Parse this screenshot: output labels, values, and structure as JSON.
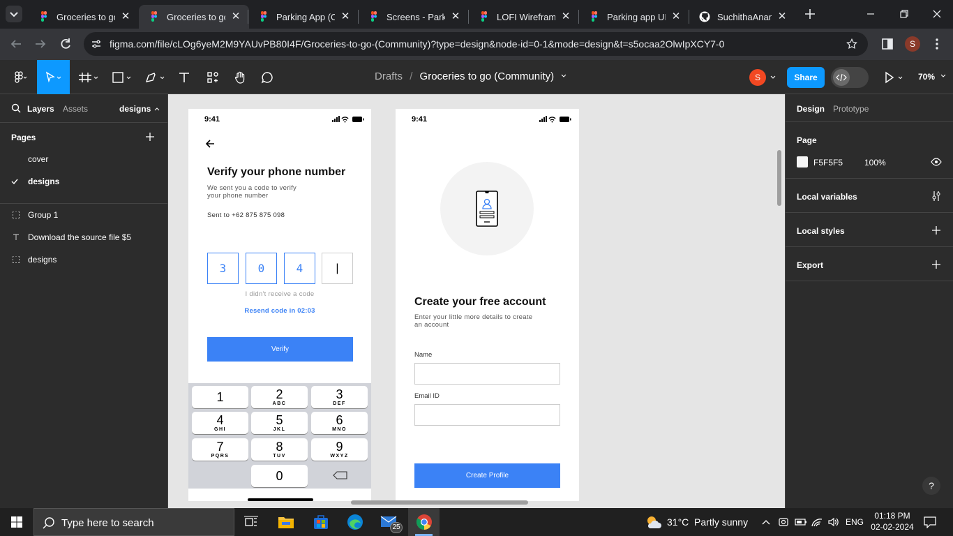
{
  "browser": {
    "tabs": [
      {
        "title": "Groceries to go |",
        "active": false
      },
      {
        "title": "Groceries to go |",
        "active": true
      },
      {
        "title": "Parking App (Co",
        "active": false
      },
      {
        "title": "Screens - Parkin",
        "active": false
      },
      {
        "title": "LOFI Wireframin",
        "active": false
      },
      {
        "title": "Parking app UI U",
        "active": false
      },
      {
        "title": "SuchithaAnand/",
        "active": false
      }
    ],
    "url": "figma.com/file/cLOg6yeM2M9YAUvPB80I4F/Groceries-to-go-(Community)?type=design&node-id=0-1&mode=design&t=s5ocaa2OlwIpXCY7-0",
    "profile_initial": "S"
  },
  "figma": {
    "breadcrumb_parent": "Drafts",
    "breadcrumb_sep": "/",
    "file_title": "Groceries to go (Community)",
    "avatar_initial": "S",
    "share_label": "Share",
    "zoom": "70%",
    "left": {
      "tab_layers": "Layers",
      "tab_assets": "Assets",
      "page_selector": "designs",
      "pages_heading": "Pages",
      "pages": [
        {
          "label": "cover",
          "selected": false
        },
        {
          "label": "designs",
          "selected": true
        }
      ],
      "layers": [
        {
          "label": "Group 1",
          "icon": "frame-icon"
        },
        {
          "label": "Download the source file $5",
          "icon": "text-icon"
        },
        {
          "label": "designs",
          "icon": "frame-icon"
        }
      ]
    },
    "right": {
      "tab_design": "Design",
      "tab_prototype": "Prototype",
      "page_heading": "Page",
      "page_color": "F5F5F5",
      "page_opacity": "100%",
      "local_variables": "Local variables",
      "local_styles": "Local styles",
      "export": "Export",
      "help": "?"
    }
  },
  "verify_screen": {
    "time": "9:41",
    "title": "Verify your phone number",
    "subtitle_line1": "We sent you a code to verify",
    "subtitle_line2": "your phone number",
    "sent_to": "Sent to +62 875 875 098",
    "code_digits": [
      "3",
      "0",
      "4",
      "|"
    ],
    "didnt_receive": "I didn't receive a code",
    "resend": "Resend code in 02:03",
    "verify_button": "Verify",
    "keypad": [
      {
        "digit": "1",
        "letters": ""
      },
      {
        "digit": "2",
        "letters": "ABC"
      },
      {
        "digit": "3",
        "letters": "DEF"
      },
      {
        "digit": "4",
        "letters": "GHI"
      },
      {
        "digit": "5",
        "letters": "JKL"
      },
      {
        "digit": "6",
        "letters": "MNO"
      },
      {
        "digit": "7",
        "letters": "PQRS"
      },
      {
        "digit": "8",
        "letters": "TUV"
      },
      {
        "digit": "9",
        "letters": "WXYZ"
      },
      {
        "digit": "0",
        "letters": ""
      }
    ]
  },
  "create_screen": {
    "time": "9:41",
    "title": "Create your free account",
    "subtitle_line1": "Enter your little more details to create",
    "subtitle_line2": "an account",
    "name_label": "Name",
    "email_label": "Email ID",
    "create_button": "Create Profile"
  },
  "taskbar": {
    "search_placeholder": "Type here to search",
    "mail_badge": "25",
    "weather": "31°C  Partly sunny",
    "language": "ENG",
    "time": "01:18 PM",
    "date": "02-02-2024"
  },
  "colors": {
    "figma_blue": "#0d99ff",
    "accent_blue": "#3b82f6",
    "dark_bg": "#2c2c2c"
  }
}
